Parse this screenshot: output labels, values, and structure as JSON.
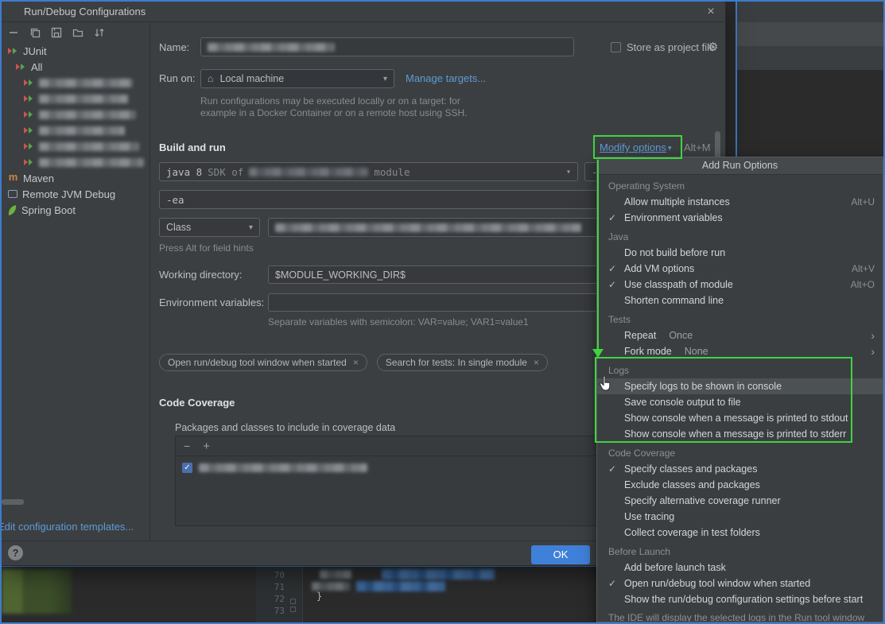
{
  "window": {
    "title": "Run/Debug Configurations"
  },
  "icons": {
    "close": "×",
    "gear": "⚙",
    "house": "⌂",
    "dropdown_arrow": "▾",
    "modify_chevron": "▾",
    "chip_close": "×",
    "checkmark": "✓",
    "submenu_arrow": "›",
    "minus": "−",
    "add": "+",
    "help": "?"
  },
  "sidebar": {
    "toolbar_icons": [
      "remove-icon",
      "copy-icon",
      "save-icon",
      "move-to-folder-icon",
      "sort-icon"
    ],
    "tree": [
      {
        "label": "JUnit",
        "icon": "junit-icon",
        "indent": 0
      },
      {
        "label": "All",
        "icon": "junit-icon",
        "indent": 1
      },
      {
        "redacted": true,
        "icon": "junit-icon",
        "indent": 2
      },
      {
        "redacted": true,
        "icon": "junit-icon",
        "indent": 2
      },
      {
        "redacted": true,
        "icon": "junit-icon",
        "indent": 2
      },
      {
        "redacted": true,
        "icon": "junit-icon",
        "indent": 2
      },
      {
        "redacted": true,
        "icon": "junit-icon",
        "indent": 2
      },
      {
        "redacted": true,
        "icon": "junit-icon",
        "indent": 2
      },
      {
        "label": "Maven",
        "icon": "maven-icon",
        "indent": 0
      },
      {
        "label": "Remote JVM Debug",
        "icon": "remote-debug-icon",
        "indent": 0
      },
      {
        "label": "Spring Boot",
        "icon": "spring-boot-icon",
        "indent": 0
      }
    ],
    "edit_templates_link": "Edit configuration templates..."
  },
  "form": {
    "name_label": "Name:",
    "name_value_redacted": true,
    "store_as_project_file_label": "Store as project file",
    "run_on_label": "Run on:",
    "run_on_value": "Local machine",
    "manage_targets_link": "Manage targets...",
    "run_on_help_line1": "Run configurations may be executed locally or on a target: for",
    "run_on_help_line2": "example in a Docker Container or on a remote host using SSH.",
    "build_and_run_title": "Build and run",
    "modify_options_label": "Modify options",
    "modify_options_shortcut": "Alt+M",
    "jre_prefix": "java 8",
    "jre_mid": "SDK of",
    "jre_suffix": "module",
    "cp_prefix": "-cp",
    "vm_options_value": "-ea",
    "class_selector_value": "Class",
    "field_hint": "Press Alt for field hints",
    "working_directory_label": "Working directory:",
    "working_directory_value": "$MODULE_WORKING_DIR$",
    "environment_variables_label": "Environment variables:",
    "environment_variables_value": "",
    "environment_variables_help": "Separate variables with semicolon: VAR=value; VAR1=value1",
    "chips": [
      "Open run/debug tool window when started",
      "Search for tests: In single module"
    ],
    "code_coverage_title": "Code Coverage",
    "coverage_packages_label": "Packages and classes to include in coverage data",
    "coverage_row_checked": true
  },
  "dialog_footer": {
    "ok_label": "OK"
  },
  "menu": {
    "title": "Add Run Options",
    "footer_note": "The IDE will display the selected logs in the Run tool window",
    "sections": [
      {
        "label": "Operating System",
        "items": [
          {
            "label": "Allow multiple instances",
            "shortcut": "Alt+U"
          },
          {
            "label": "Environment variables",
            "checked": true
          }
        ]
      },
      {
        "label": "Java",
        "items": [
          {
            "label": "Do not build before run"
          },
          {
            "label": "Add VM options",
            "checked": true,
            "shortcut": "Alt+V"
          },
          {
            "label": "Use classpath of module",
            "checked": true,
            "shortcut": "Alt+O"
          },
          {
            "label": "Shorten command line"
          }
        ]
      },
      {
        "label": "Tests",
        "items": [
          {
            "label": "Repeat",
            "value": "Once",
            "submenu": true
          },
          {
            "label": "Fork mode",
            "value": "None",
            "submenu": true
          }
        ]
      },
      {
        "label": "Logs",
        "items": [
          {
            "label": "Specify logs to be shown in console",
            "highlighted": true
          },
          {
            "label": "Save console output to file"
          },
          {
            "label": "Show console when a message is printed to stdout"
          },
          {
            "label": "Show console when a message is printed to stderr"
          }
        ]
      },
      {
        "label": "Code Coverage",
        "items": [
          {
            "label": "Specify classes and packages",
            "checked": true
          },
          {
            "label": "Exclude classes and packages"
          },
          {
            "label": "Specify alternative coverage runner"
          },
          {
            "label": "Use tracing"
          },
          {
            "label": "Collect coverage in test folders"
          }
        ]
      },
      {
        "label": "Before Launch",
        "items": [
          {
            "label": "Add before launch task"
          },
          {
            "label": "Open run/debug tool window when started",
            "checked": true
          },
          {
            "label": "Show the run/debug configuration settings before start"
          }
        ]
      }
    ]
  },
  "editor": {
    "line_numbers": [
      "70",
      "71",
      "72",
      "73"
    ],
    "visible_code": "}"
  }
}
